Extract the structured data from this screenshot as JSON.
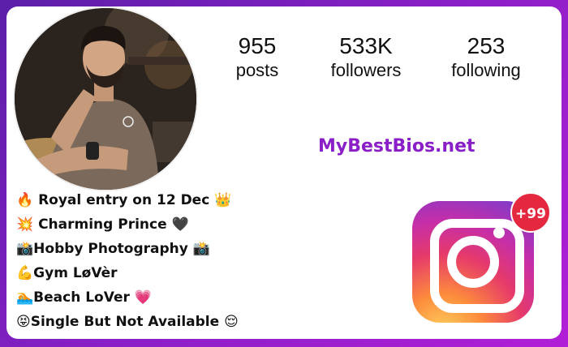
{
  "profile": {
    "stats": [
      {
        "value": "955",
        "label": "posts"
      },
      {
        "value": "533K",
        "label": "followers"
      },
      {
        "value": "253",
        "label": "following"
      }
    ],
    "watermark": "MyBestBios.net",
    "bio": [
      "🔥 Royal entry on 12 Dec 👑",
      "💥 Charming Prince 🖤",
      "📸Hobby Photography 📸",
      "💪Gym LøVèr",
      "🏊Beach LoVer 💗",
      "😝Single But Not Available 😌"
    ]
  },
  "instagram": {
    "badge": "+99",
    "colors": [
      "#fdd560",
      "#fd8c3c",
      "#e63a6a",
      "#c62ea8",
      "#6b3fd4"
    ]
  },
  "frame_color": "#8a1fc7"
}
